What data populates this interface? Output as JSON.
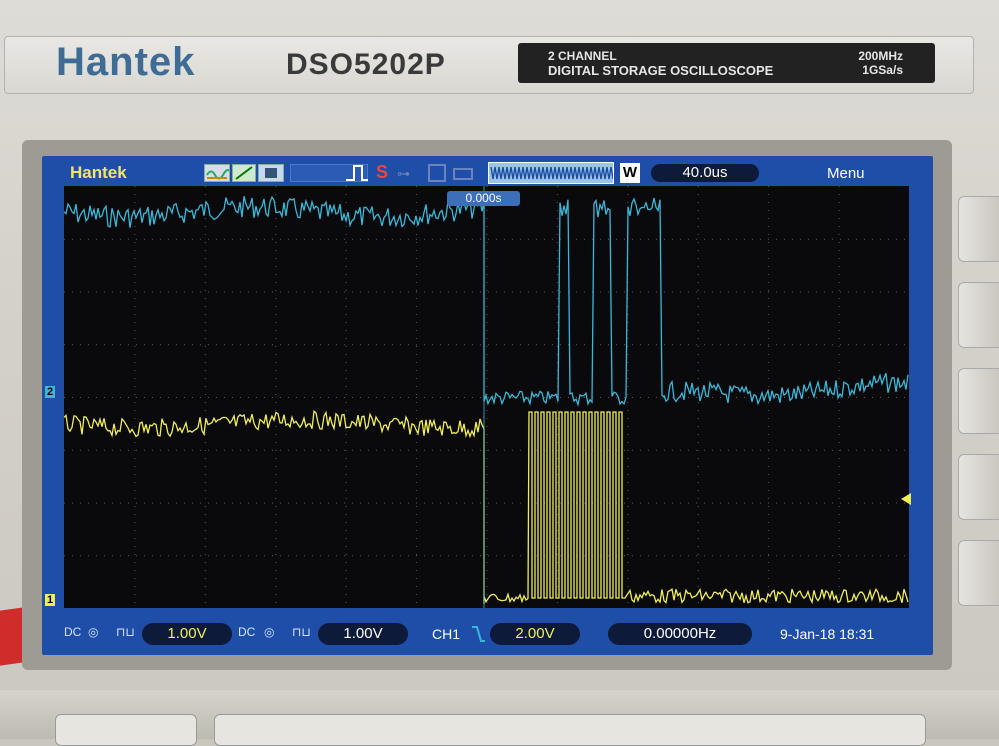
{
  "device": {
    "brand": "Hantek",
    "model": "DSO5202P",
    "spec_line1": "2 CHANNEL",
    "spec_line2": "DIGITAL STORAGE OSCILLOSCOPE",
    "bandwidth": "200MHz",
    "sample_rate": "1GSa/s"
  },
  "screen": {
    "header_brand": "Hantek",
    "trigger_icon_letter": "S",
    "window_label": "W",
    "timebase": "40.0us",
    "menu_label": "Menu",
    "trigger_position": "0.000s",
    "ch2_marker": "2",
    "ch1_marker": "1",
    "colors": {
      "ch1": "#f0ee55",
      "ch2": "#39b8d8",
      "screen_bg": "#1f4ea8"
    }
  },
  "status_bar": {
    "ch1_coupling": "DC",
    "ch1_scale": "1.00V",
    "ch2_coupling": "DC",
    "ch2_scale": "1.00V",
    "trigger_source": "CH1",
    "trigger_level": "2.00V",
    "frequency": "0.00000Hz",
    "date_time": "9-Jan-18 18:31"
  }
}
